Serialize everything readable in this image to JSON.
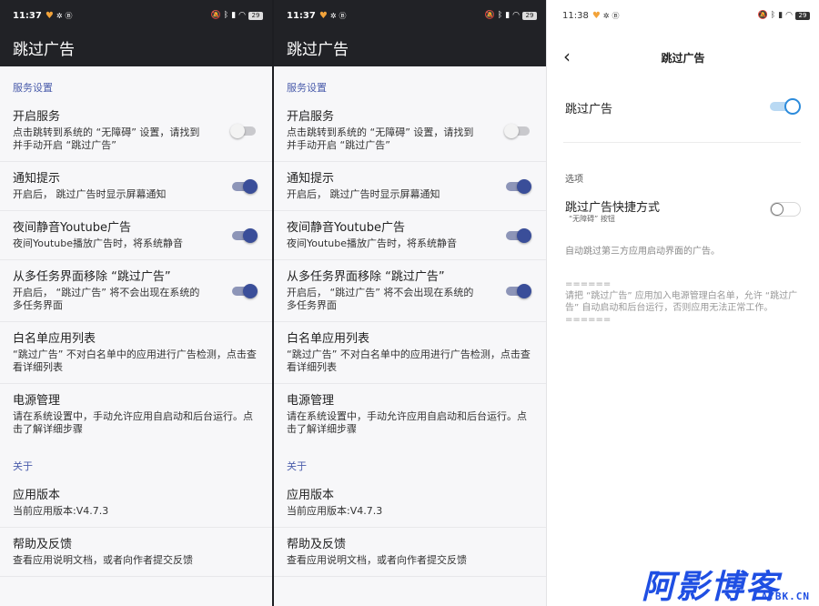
{
  "status_bar": {
    "time_dark": "11:37",
    "time_light": "11:38",
    "battery": "29"
  },
  "app": {
    "title": "跳过广告",
    "sections": {
      "service": "服务设置",
      "about": "关于"
    },
    "items": [
      {
        "title": "开启服务",
        "subtitle": "点击跳转到系统的 “无障碍” 设置，请找到并手动开启 “跳过广告”",
        "switch": false
      },
      {
        "title": "通知提示",
        "subtitle": "开启后， 跳过广告时显示屏幕通知",
        "switch": true
      },
      {
        "title": "夜间静音Youtube广告",
        "subtitle": "夜间Youtube播放广告时，将系统静音",
        "switch": true
      },
      {
        "title": "从多任务界面移除 “跳过广告”",
        "subtitle": "开启后， “跳过广告” 将不会出现在系统的多任务界面",
        "switch": true
      },
      {
        "title": "白名单应用列表",
        "subtitle": "“跳过广告” 不对白名单中的应用进行广告检测，点击查看详细列表"
      },
      {
        "title": "电源管理",
        "subtitle": "请在系统设置中，手动允许应用自启动和后台运行。点击了解详细步骤"
      }
    ],
    "about_items": [
      {
        "title": "应用版本",
        "subtitle": "当前应用版本:V4.7.3"
      },
      {
        "title": "帮助及反馈",
        "subtitle": "查看应用说明文档，或者向作者提交反馈"
      }
    ]
  },
  "accessibility_page": {
    "title": "跳过广告",
    "main_toggle_label": "跳过广告",
    "main_toggle_on": true,
    "options_header": "选项",
    "shortcut_label": "跳过广告快捷方式",
    "shortcut_sub": "“无障碍” 按钮",
    "shortcut_on": false,
    "description": "自动跳过第三方应用启动界面的广告。",
    "note_line1": "======",
    "note_body": "请把 “跳过广告” 应用加入电源管理白名单，允许 “跳过广告” 自动启动和后台运行，否则应用无法正常工作。",
    "note_line2": "======"
  },
  "watermark": {
    "text": "阿影博客",
    "site": "AYBK.CN"
  }
}
